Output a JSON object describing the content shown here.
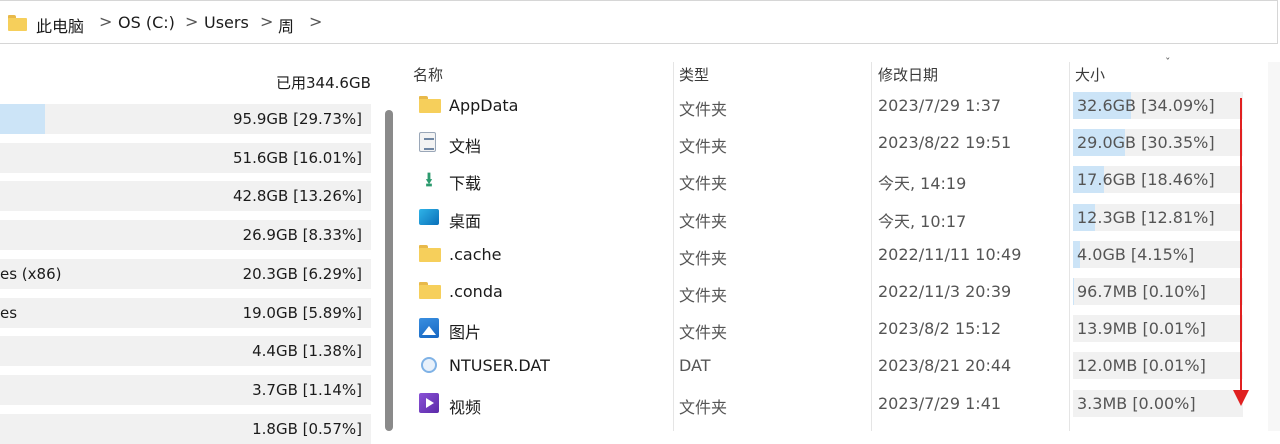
{
  "breadcrumb": {
    "items": [
      "此电脑",
      "OS (C:)",
      "Users",
      "周"
    ],
    "separator": ">"
  },
  "left_pane": {
    "used_label": "已用344.6GB",
    "rows": [
      {
        "name": "",
        "value": "95.9GB [29.73%]",
        "fraction": 0.1212
      },
      {
        "name": "",
        "value": "51.6GB [16.01%]",
        "fraction": 0
      },
      {
        "name": "",
        "value": "42.8GB [13.26%]",
        "fraction": 0
      },
      {
        "name": "",
        "value": "26.9GB [8.33%]",
        "fraction": 0
      },
      {
        "name": "es (x86)",
        "value": "20.3GB [6.29%]",
        "fraction": 0
      },
      {
        "name": "es",
        "value": "19.0GB [5.89%]",
        "fraction": 0
      },
      {
        "name": "",
        "value": "4.4GB [1.38%]",
        "fraction": 0
      },
      {
        "name": "",
        "value": "3.7GB [1.14%]",
        "fraction": 0
      },
      {
        "name": "",
        "value": "1.8GB [0.57%]",
        "fraction": 0
      }
    ]
  },
  "columns": {
    "name": "名称",
    "type": "类型",
    "modified": "修改日期",
    "size": "大小",
    "sort_indicator": "ˇ"
  },
  "files": [
    {
      "icon": "folder-icon",
      "name": "AppData",
      "type": "文件夹",
      "date": "2023/7/29 1:37",
      "size": "32.6GB [34.09%]",
      "fraction": 0.3409
    },
    {
      "icon": "document-icon",
      "name": "文档",
      "type": "文件夹",
      "date": "2023/8/22 19:51",
      "size": "29.0GB [30.35%]",
      "fraction": 0.3035
    },
    {
      "icon": "download-icon",
      "name": "下载",
      "type": "文件夹",
      "date": "今天, 14:19",
      "size": "17.6GB [18.46%]",
      "fraction": 0.1846
    },
    {
      "icon": "desktop-icon",
      "name": "桌面",
      "type": "文件夹",
      "date": "今天, 10:17",
      "size": "12.3GB [12.81%]",
      "fraction": 0.1281
    },
    {
      "icon": "folder-icon",
      "name": ".cache",
      "type": "文件夹",
      "date": "2022/11/11 10:49",
      "size": "4.0GB [4.15%]",
      "fraction": 0.0415
    },
    {
      "icon": "folder-icon",
      "name": ".conda",
      "type": "文件夹",
      "date": "2022/11/3 20:39",
      "size": "96.7MB [0.10%]",
      "fraction": 0.001
    },
    {
      "icon": "pictures-icon",
      "name": "图片",
      "type": "文件夹",
      "date": "2023/8/2 15:12",
      "size": "13.9MB [0.01%]",
      "fraction": 0.0001
    },
    {
      "icon": "dat-file-icon",
      "name": "NTUSER.DAT",
      "type": "DAT",
      "date": "2023/8/21 20:44",
      "size": "12.0MB [0.01%]",
      "fraction": 0.0001
    },
    {
      "icon": "videos-icon",
      "name": "视频",
      "type": "文件夹",
      "date": "2023/7/29 1:41",
      "size": "3.3MB [0.00%]",
      "fraction": 0
    }
  ],
  "colors": {
    "size_bar": "#cce4f7",
    "bar_track": "#f1f1f1",
    "annotation_arrow": "#e02020",
    "folder": "#f6cf5b"
  }
}
